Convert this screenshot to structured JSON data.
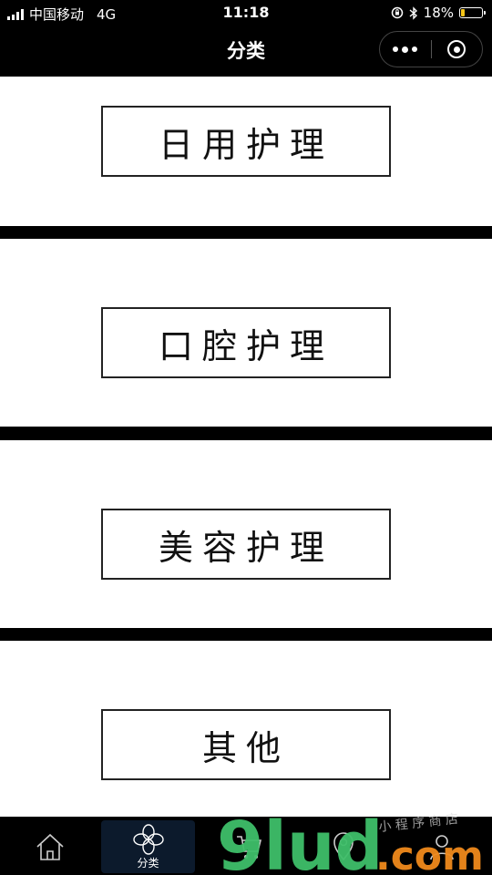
{
  "status_bar": {
    "carrier": "中国移动",
    "network": "4G",
    "time": "11:18",
    "battery": "18%",
    "battery_level": 0.18
  },
  "nav": {
    "title": "分类"
  },
  "categories": [
    {
      "label": "日用护理"
    },
    {
      "label": "口腔护理"
    },
    {
      "label": "美容护理"
    },
    {
      "label": "其他"
    }
  ],
  "tabbar": {
    "tabs": [
      {
        "label": "",
        "icon": "home-icon"
      },
      {
        "label": "分类",
        "icon": "category-icon",
        "active": true
      },
      {
        "label": "",
        "icon": "cart-icon"
      },
      {
        "label": "",
        "icon": "location-icon"
      },
      {
        "label": "",
        "icon": "user-icon"
      }
    ]
  },
  "watermark": {
    "logo_text": "9lud.com",
    "tagline": "小程序商店"
  },
  "colors": {
    "background": "#000000",
    "panel": "#ffffff",
    "active_tab": "#0c1a2c",
    "battery_fill": "#f5c518",
    "watermark_green": "#3fbf6a",
    "watermark_orange": "#f08a1c"
  }
}
